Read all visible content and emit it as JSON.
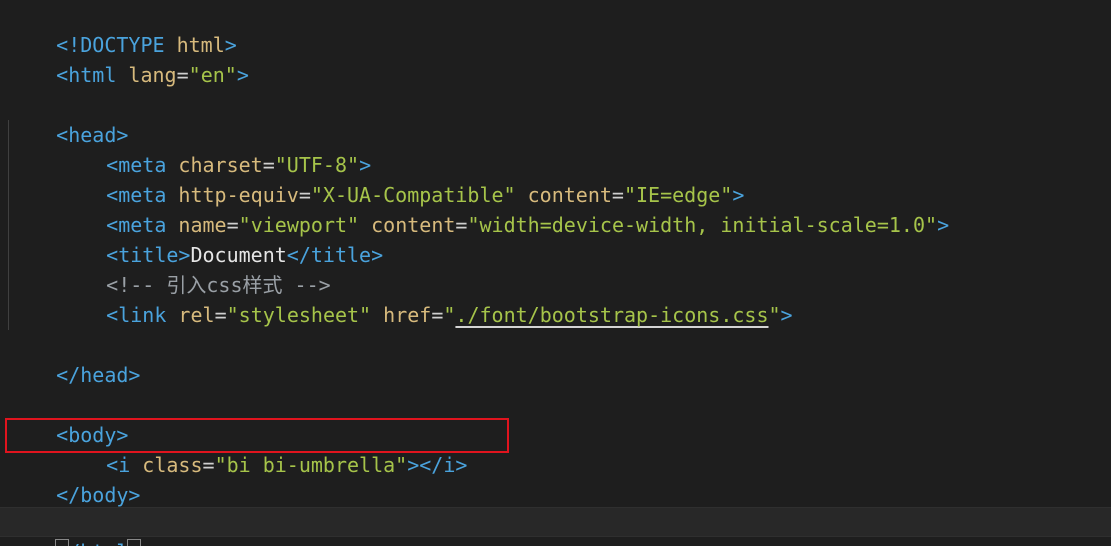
{
  "colors": {
    "background": "#1e1e1e",
    "tag": "#4aa3dd",
    "attribute": "#d7ba7d",
    "string": "#a6c44a",
    "highlight_box": "#e0141e"
  },
  "code": {
    "l1": {
      "open": "<!DOCTYPE",
      "name": " html",
      "close": ">"
    },
    "l2": {
      "open": "<html",
      "attr": " lang",
      "eq": "=",
      "val": "\"en\"",
      "close": ">"
    },
    "l4": {
      "text": "<head>"
    },
    "l5": {
      "open": "<meta",
      "attr1": " charset",
      "eq1": "=",
      "val1": "\"UTF-8\"",
      "close": ">"
    },
    "l6": {
      "open": "<meta",
      "attr1": " http-equiv",
      "eq1": "=",
      "val1": "\"X-UA-Compatible\"",
      "attr2": " content",
      "eq2": "=",
      "val2": "\"IE=edge\"",
      "close": ">"
    },
    "l7": {
      "open": "<meta",
      "attr1": " name",
      "eq1": "=",
      "val1": "\"viewport\"",
      "attr2": " content",
      "eq2": "=",
      "val2": "\"width=device-width, initial-scale=1.0\"",
      "close": ">"
    },
    "l8": {
      "open": "<title>",
      "text": "Document",
      "close": "</title>"
    },
    "l9": {
      "comment": "<!-- 引入css样式 -->"
    },
    "l10": {
      "open": "<link",
      "attr1": " rel",
      "eq1": "=",
      "val1": "\"stylesheet\"",
      "attr2": " href",
      "eq2": "=",
      "q1": "\"",
      "val2": "./font/bootstrap-icons.css",
      "q2": "\"",
      "close": ">"
    },
    "l12": {
      "text": "</head>"
    },
    "l14": {
      "text": "<body>"
    },
    "l15": {
      "open": "<i",
      "attr1": " class",
      "eq1": "=",
      "val1": "\"bi bi-umbrella\"",
      "close": "></i>"
    },
    "l16": {
      "text": "</body>"
    },
    "l18": {
      "b1": "<",
      "slash": "/",
      "name": "html",
      "b2": ">"
    }
  }
}
